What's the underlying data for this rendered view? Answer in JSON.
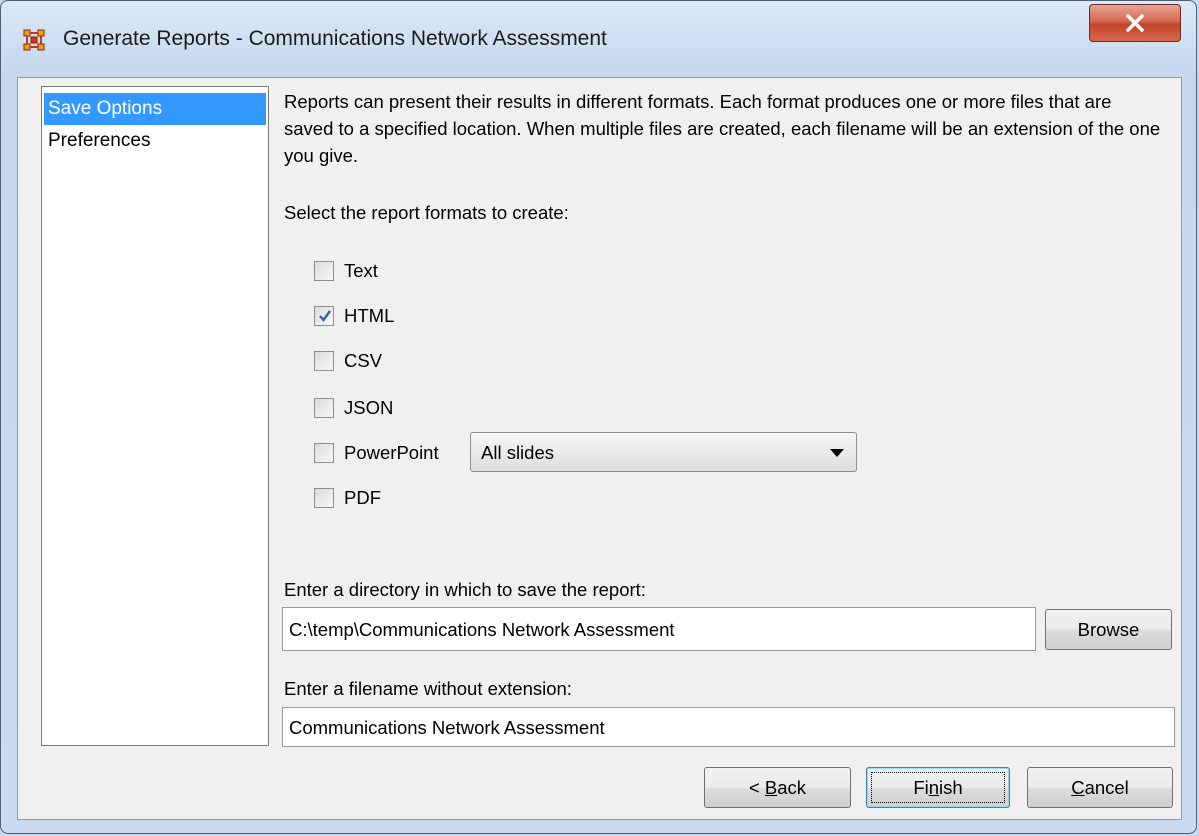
{
  "window": {
    "title": "Generate Reports - Communications Network Assessment"
  },
  "nav": {
    "items": [
      {
        "label": "Save Options",
        "selected": true
      },
      {
        "label": "Preferences",
        "selected": false
      }
    ]
  },
  "description": "Reports can present their results in different formats. Each format produces one or more files that are saved to a specified location. When multiple files are created, each filename will be an extension of the one you give.",
  "formats": {
    "prompt": "Select the report formats to create:",
    "options": [
      {
        "label": "Text",
        "checked": false
      },
      {
        "label": "HTML",
        "checked": true
      },
      {
        "label": "CSV",
        "checked": false
      },
      {
        "label": "JSON",
        "checked": false
      },
      {
        "label": "PowerPoint",
        "checked": false
      },
      {
        "label": "PDF",
        "checked": false
      }
    ],
    "powerpoint_select": "All slides"
  },
  "directory": {
    "prompt": "Enter a directory in which to save the report:",
    "value": "C:\\temp\\Communications Network Assessment",
    "browse_label": "Browse"
  },
  "filename": {
    "prompt": "Enter a filename without extension:",
    "value": "Communications Network Assessment"
  },
  "buttons": {
    "back": {
      "pre": "< ",
      "mnemonic": "B",
      "post": "ack"
    },
    "finish": {
      "pre": "Fi",
      "mnemonic": "n",
      "post": "ish"
    },
    "cancel": {
      "pre": "",
      "mnemonic": "C",
      "post": "ancel"
    }
  },
  "colors": {
    "selection": "#3399ff",
    "close_button": "#c9452c"
  },
  "icons": {
    "app": "network-icon",
    "close": "close-x-icon",
    "dropdown": "triangle-down-icon",
    "check": "checkmark-icon"
  }
}
